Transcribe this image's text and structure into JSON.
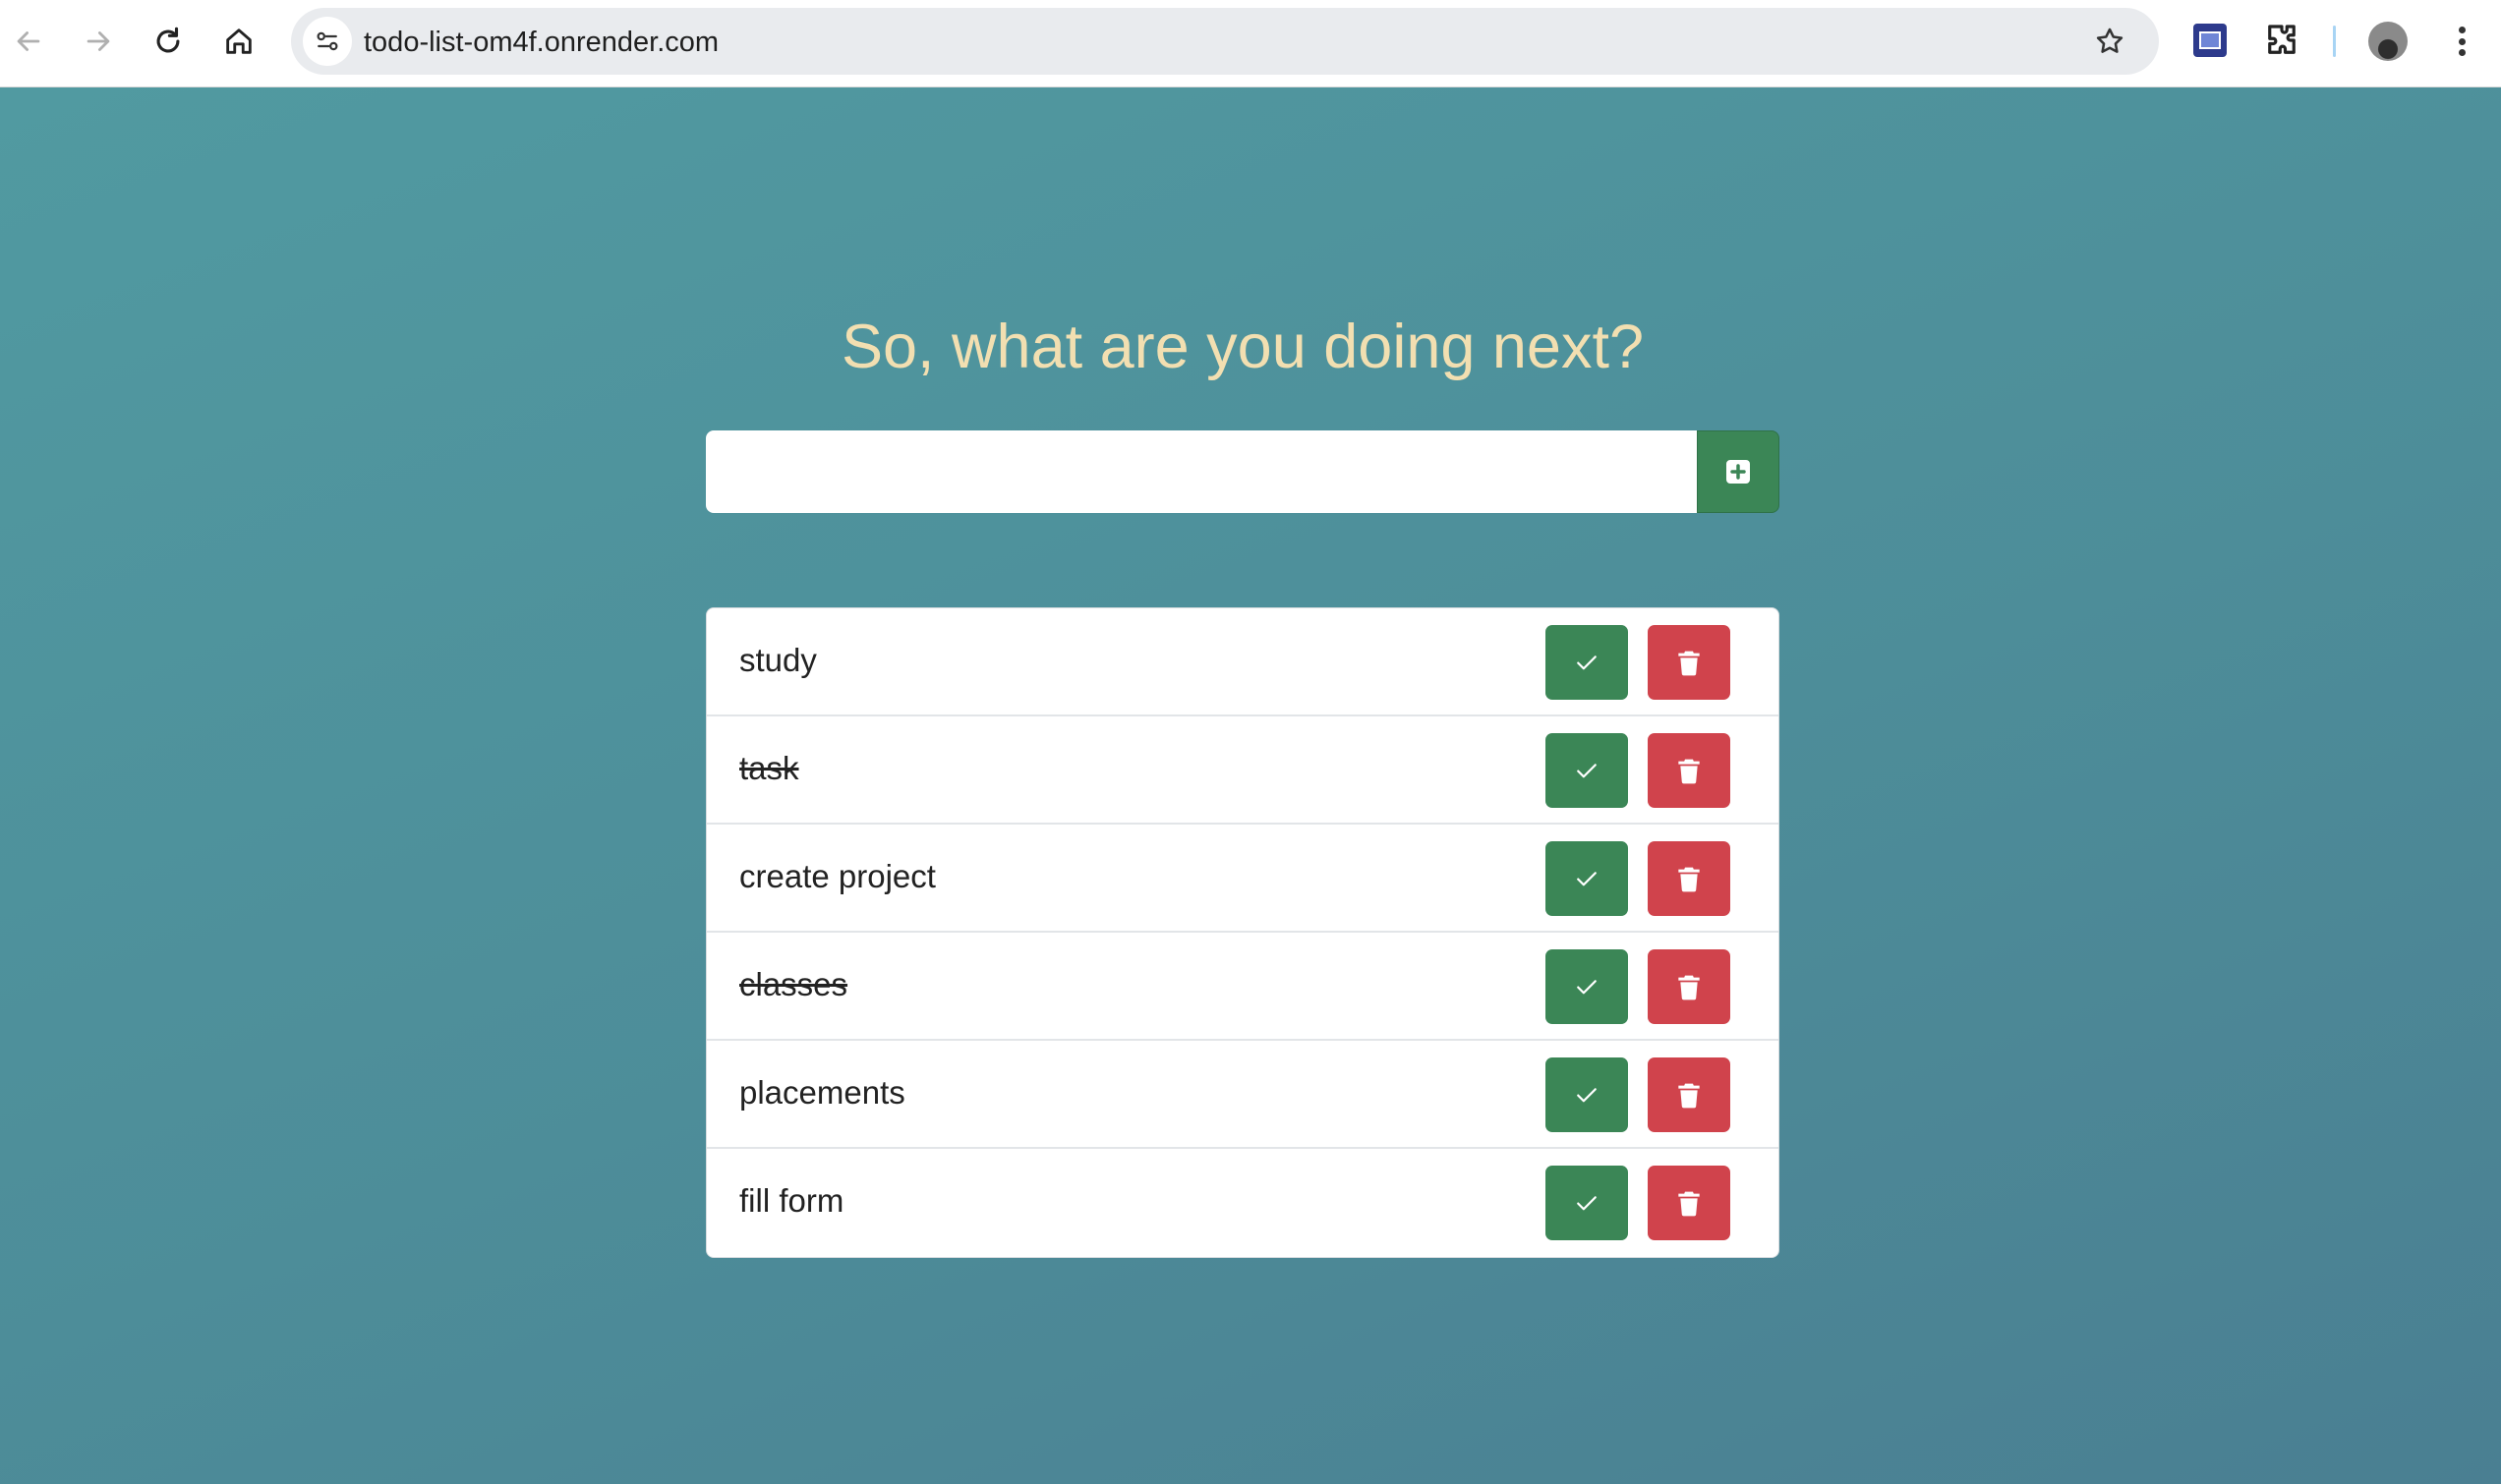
{
  "browser": {
    "url": "todo-list-om4f.onrender.com",
    "nav_icons": [
      "back-arrow-icon",
      "forward-arrow-icon",
      "reload-icon",
      "home-icon"
    ],
    "right_icons": [
      "bookmark-star-icon",
      "extension-icon",
      "puzzle-icon",
      "profile-avatar",
      "kebab-menu-icon"
    ]
  },
  "app": {
    "heading": "So, what are you doing next?",
    "input": {
      "value": "",
      "placeholder": ""
    },
    "add_button_icon": "plus-square-icon",
    "colors": {
      "background_start": "#519aa1",
      "background_end": "#4a7f92",
      "heading": "#f2dfb1",
      "check_button": "#3b8656",
      "delete_button": "#d0434c"
    },
    "tasks": [
      {
        "text": "study",
        "done": false
      },
      {
        "text": "task",
        "done": true
      },
      {
        "text": "create project",
        "done": false
      },
      {
        "text": "classes",
        "done": true
      },
      {
        "text": "placements",
        "done": false
      },
      {
        "text": "fill form",
        "done": false
      }
    ]
  }
}
